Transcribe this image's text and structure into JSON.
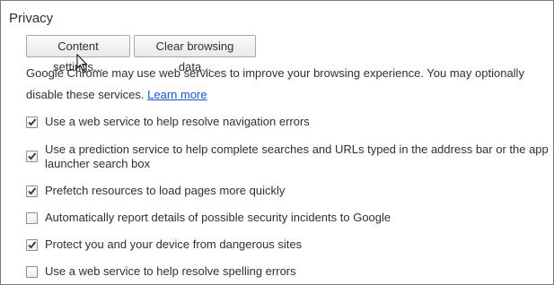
{
  "section": {
    "title": "Privacy"
  },
  "buttons": {
    "content_settings": "Content settings...",
    "clear_browsing_data": "Clear browsing data..."
  },
  "description": {
    "text": "Google Chrome may use web services to improve your browsing experience. You may optionally disable these services.",
    "link": "Learn more"
  },
  "options": [
    {
      "label": "Use a web service to help resolve navigation errors",
      "checked": true
    },
    {
      "label": "Use a prediction service to help complete searches and URLs typed in the address bar or the app launcher search box",
      "checked": true
    },
    {
      "label": "Prefetch resources to load pages more quickly",
      "checked": true
    },
    {
      "label": "Automatically report details of possible security incidents to Google",
      "checked": false
    },
    {
      "label": "Protect you and your device from dangerous sites",
      "checked": true
    },
    {
      "label": "Use a web service to help resolve spelling errors",
      "checked": false
    }
  ],
  "colors": {
    "link": "#1a55c7",
    "text": "#303030",
    "border": "#7a7a7a"
  },
  "icons": {
    "checkbox_mark": "checkmark-icon",
    "pointer": "mouse-cursor-icon"
  }
}
